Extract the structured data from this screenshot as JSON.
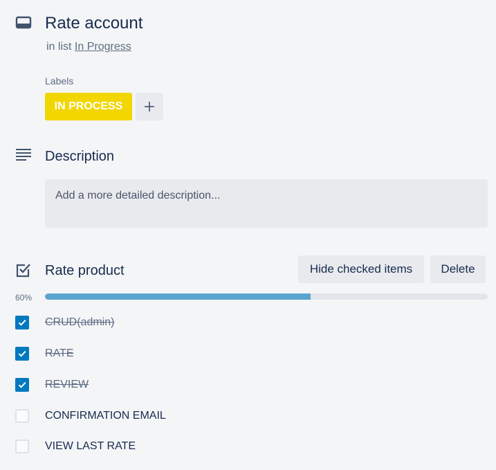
{
  "card": {
    "title": "Rate account",
    "in_list_prefix": "in list",
    "list_name": "In Progress"
  },
  "labels": {
    "heading": "Labels",
    "items": [
      {
        "text": "IN PROCESS",
        "color": "#f2d600"
      }
    ],
    "add_icon": "plus-icon"
  },
  "description": {
    "heading": "Description",
    "placeholder": "Add a more detailed description..."
  },
  "checklist": {
    "title": "Rate product",
    "hide_checked_label": "Hide checked items",
    "delete_label": "Delete",
    "progress_label": "60%",
    "progress": 0.6,
    "progress_color": "#5ba4cf",
    "items": [
      {
        "text": "CRUD(admin)",
        "checked": true
      },
      {
        "text": "RATE",
        "checked": true
      },
      {
        "text": "REVIEW",
        "checked": true
      },
      {
        "text": "CONFIRMATION EMAIL",
        "checked": false
      },
      {
        "text": "VIEW LAST RATE",
        "checked": false
      }
    ]
  },
  "colors": {
    "background": "#f4f5f7",
    "check_blue": "#0079bf",
    "text": "#172b4d",
    "muted": "#5e6c84"
  }
}
